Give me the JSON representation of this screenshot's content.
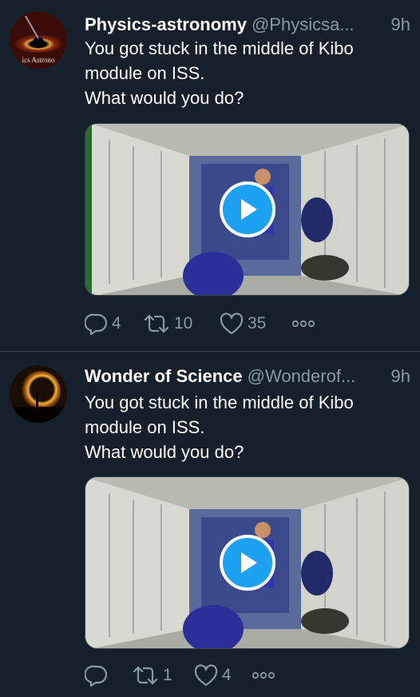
{
  "tweets": [
    {
      "display_name": "Physics-astronomy",
      "handle": "@Physicsa...",
      "time": "9h",
      "text_lines": [
        "You got stuck in the middle of Kibo",
        "module on ISS.",
        "What would you do?"
      ],
      "avatar_text": "ics Astrono",
      "media": {
        "type": "video",
        "icon": "play-icon"
      },
      "actions": {
        "replies": "4",
        "retweets": "10",
        "likes": "35"
      }
    },
    {
      "display_name": "Wonder of Science",
      "handle": "@Wonderof...",
      "time": "9h",
      "text_lines": [
        "You got stuck in the middle of Kibo",
        "module on ISS.",
        "What would you do?"
      ],
      "media": {
        "type": "video",
        "icon": "play-icon"
      },
      "actions": {
        "replies": "",
        "retweets": "1",
        "likes": "4"
      }
    }
  ],
  "colors": {
    "background": "#15202b",
    "text_primary": "#ffffff",
    "text_secondary": "#8899a6",
    "accent": "#1da1f2",
    "divider": "#38444d"
  }
}
